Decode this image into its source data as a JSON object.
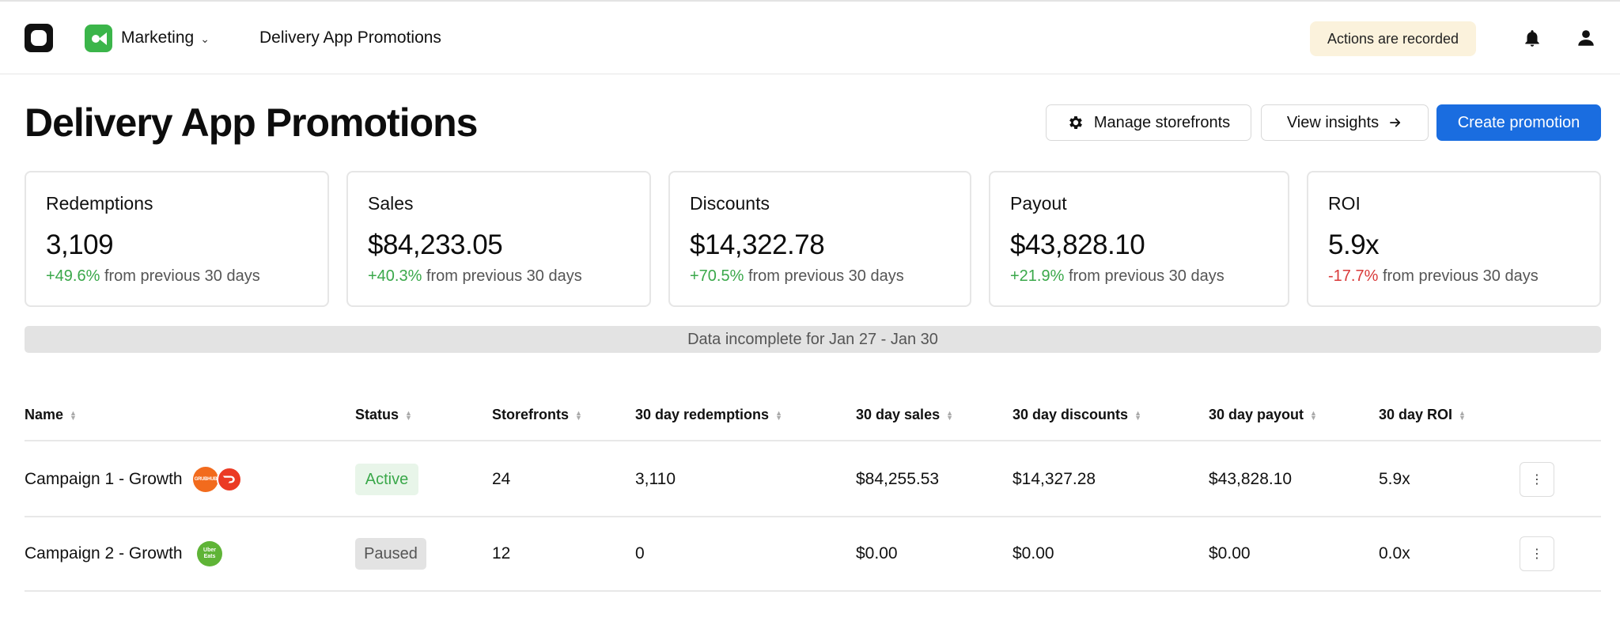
{
  "topbar": {
    "app_name": "Marketing",
    "breadcrumb": "Delivery App Promotions",
    "recorded_notice": "Actions are recorded"
  },
  "page": {
    "title": "Delivery App Promotions",
    "buttons": {
      "manage": "Manage storefronts",
      "insights": "View insights",
      "create": "Create promotion"
    }
  },
  "stats": [
    {
      "label": "Redemptions",
      "value": "3,109",
      "delta": "+49.6%",
      "delta_text": "from previous 30 days"
    },
    {
      "label": "Sales",
      "value": "$84,233.05",
      "delta": "+40.3%",
      "delta_text": "from previous 30 days"
    },
    {
      "label": "Discounts",
      "value": "$14,322.78",
      "delta": "+70.5%",
      "delta_text": "from previous 30 days"
    },
    {
      "label": "Payout",
      "value": "$43,828.10",
      "delta": "+21.9%",
      "delta_text": "from previous 30 days"
    },
    {
      "label": "ROI",
      "value": "5.9x",
      "delta": "-17.7%",
      "delta_text": "from previous 30 days"
    }
  ],
  "notice": "Data incomplete for Jan 27 - Jan 30",
  "table": {
    "columns": [
      "Name",
      "Status",
      "Storefronts",
      "30 day redemptions",
      "30 day sales",
      "30 day discounts",
      "30 day payout",
      "30 day ROI"
    ],
    "rows": [
      {
        "name": "Campaign 1 - Growth",
        "services": [
          "GRUBHUB",
          "DoorDash"
        ],
        "status": "Active",
        "storefronts": "24",
        "redemptions": "3,110",
        "sales": "$84,255.53",
        "discounts": "$14,327.28",
        "payout": "$43,828.10",
        "roi": "5.9x"
      },
      {
        "name": "Campaign 2 - Growth",
        "services": [
          "Uber Eats"
        ],
        "status": "Paused",
        "storefronts": "12",
        "redemptions": "0",
        "sales": "$0.00",
        "discounts": "$0.00",
        "payout": "$0.00",
        "roi": "0.0x"
      }
    ]
  },
  "colors": {
    "primary": "#1a6de0",
    "positive": "#3aa84a",
    "negative": "#d93a3a",
    "app_icon": "#3bb54a",
    "recorded_bg": "#fbf2dc"
  },
  "icons": {
    "logo": "logo-icon",
    "app": "marketing-app-icon",
    "notifications": "bell-icon",
    "account": "user-icon",
    "settings": "gear-icon",
    "arrow": "arrow-right-icon",
    "row_menu": "more-vertical-icon"
  }
}
